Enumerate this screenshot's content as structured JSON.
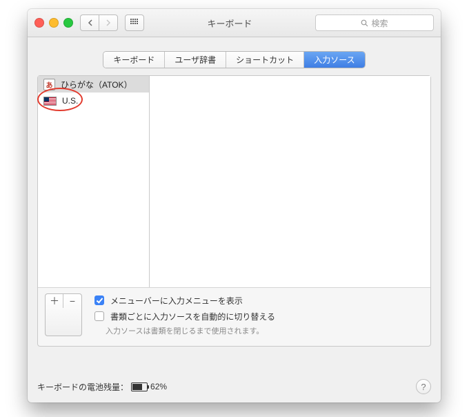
{
  "header": {
    "title": "キーボード",
    "search_placeholder": "検索"
  },
  "tabs": [
    {
      "label": "キーボード",
      "active": false
    },
    {
      "label": "ユーザ辞書",
      "active": false
    },
    {
      "label": "ショートカット",
      "active": false
    },
    {
      "label": "入力ソース",
      "active": true
    }
  ],
  "sources": [
    {
      "label": "ひらがな（ATOK）",
      "icon": "atok-icon",
      "selected": true
    },
    {
      "label": "U.S.",
      "icon": "us-flag-icon",
      "selected": false
    }
  ],
  "buttons": {
    "add": "＋",
    "remove": "−"
  },
  "options": {
    "show_input_menu": "メニューバーに入力メニューを表示",
    "show_input_menu_checked": true,
    "auto_switch": "書類ごとに入力ソースを自動的に切り替える",
    "auto_switch_checked": false,
    "auto_switch_hint": "入力ソースは書類を閉じるまで使用されます。"
  },
  "footer": {
    "battery_label": "キーボードの電池残量：",
    "battery_percent": "62%"
  }
}
